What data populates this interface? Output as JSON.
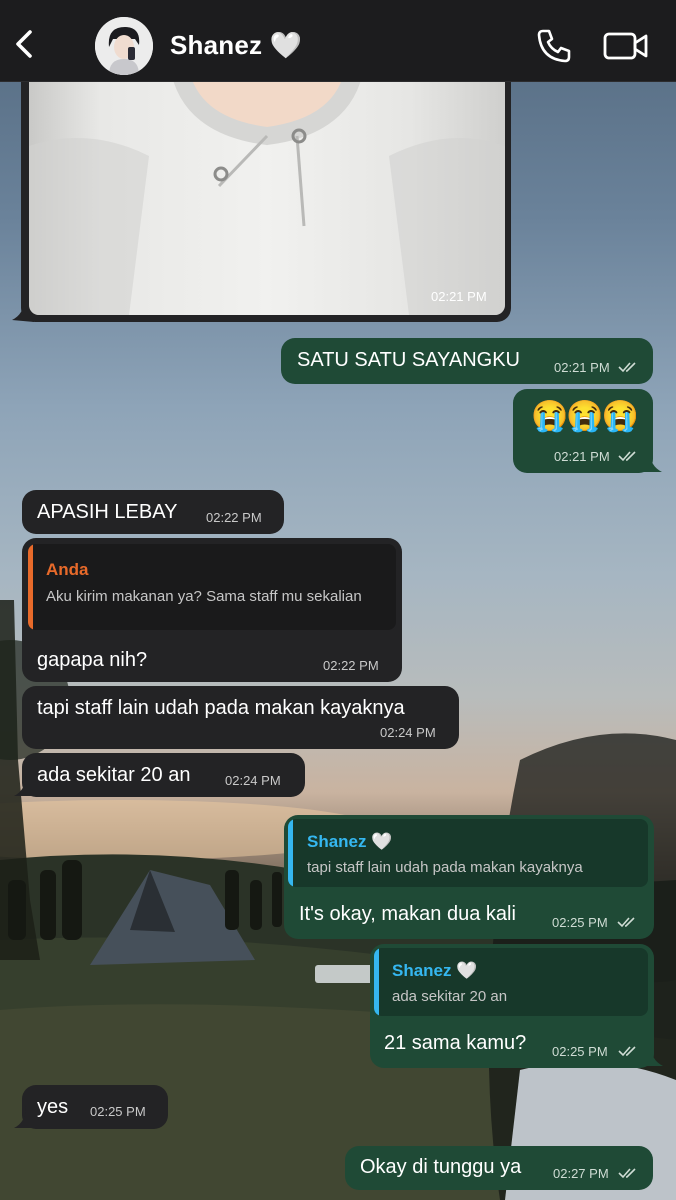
{
  "header": {
    "contact_name": "Shanez 🤍",
    "back_icon": "chevron-left-icon",
    "call_icon": "phone-icon",
    "video_icon": "video-camera-icon"
  },
  "colors": {
    "topbar": "#1c1c1e",
    "incoming_bubble": "#232325",
    "outgoing_bubble": "#1f4a36",
    "quote_you": "#e86a2a",
    "quote_contact": "#35b7f0"
  },
  "messages": [
    {
      "type": "photo",
      "direction": "in",
      "time": "02:21 PM"
    },
    {
      "direction": "out",
      "text": "SATU SATU SAYANGKU",
      "time": "02:21 PM"
    },
    {
      "direction": "out",
      "text": "😭😭😭",
      "time": "02:21 PM"
    },
    {
      "direction": "in",
      "text": "APASIH LEBAY",
      "time": "02:22 PM"
    },
    {
      "direction": "in",
      "text": "gapapa nih?",
      "time": "02:22 PM",
      "reply_to": {
        "name": "Anda",
        "text": "Aku kirim makanan ya? Sama staff mu sekalian"
      }
    },
    {
      "direction": "in",
      "text": "tapi staff lain udah pada makan kayaknya",
      "time": "02:24 PM"
    },
    {
      "direction": "in",
      "text": "ada sekitar 20 an",
      "time": "02:24 PM"
    },
    {
      "direction": "out",
      "text": "It's okay, makan dua kali",
      "time": "02:25 PM",
      "reply_to": {
        "name": "Shanez 🤍",
        "text": "tapi staff lain udah pada makan kayaknya"
      }
    },
    {
      "direction": "out",
      "text": "21 sama kamu?",
      "time": "02:25 PM",
      "reply_to": {
        "name": "Shanez 🤍",
        "text": "ada sekitar 20 an"
      }
    },
    {
      "direction": "in",
      "text": "yes",
      "time": "02:25 PM"
    },
    {
      "direction": "out",
      "text": "Okay di tunggu ya",
      "time": "02:27 PM"
    }
  ]
}
